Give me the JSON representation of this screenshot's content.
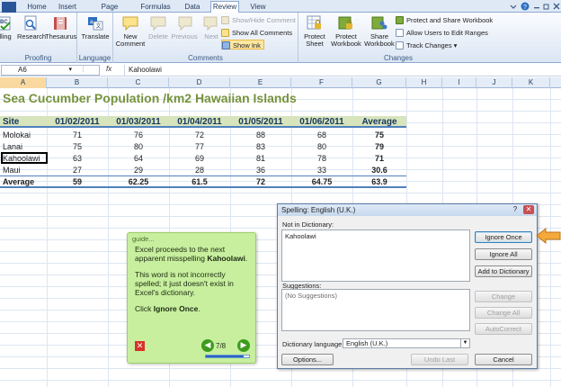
{
  "ribbon": {
    "tabs": [
      "Home",
      "Insert",
      "Page Layout",
      "Formulas",
      "Data",
      "Review",
      "View"
    ],
    "active_tab": "Review",
    "proofing": {
      "spelling": "lling",
      "research": "Research",
      "thesaurus": "Thesaurus",
      "label": "Proofing"
    },
    "language": {
      "translate": "Translate",
      "label": "Language"
    },
    "comments": {
      "new_comment": "New Comment",
      "delete": "Delete",
      "previous": "Previous",
      "next": "Next",
      "show_hide": "Show/Hide Comment",
      "show_all": "Show All Comments",
      "show_ink": "Show Ink",
      "label": "Comments"
    },
    "changes": {
      "protect_sheet": "Protect Sheet",
      "protect_workbook": "Protect Workbook",
      "share_workbook": "Share Workbook",
      "protect_share": "Protect and Share Workbook",
      "allow_users": "Allow Users to Edit Ranges",
      "track_changes": "Track Changes",
      "label": "Changes"
    }
  },
  "formula_bar": {
    "name_box": "A6",
    "fx": "fx",
    "value": "Kahoolawi"
  },
  "columns": [
    "A",
    "B",
    "C",
    "D",
    "E",
    "F",
    "G",
    "H",
    "I",
    "J",
    "K"
  ],
  "sheet": {
    "title": "Sea Cucumber Population /km2 Hawaiian Islands",
    "headers": [
      "Site",
      "01/02/2011",
      "01/03/2011",
      "01/04/2011",
      "01/05/2011",
      "01/06/2011",
      "Average"
    ],
    "rows": [
      [
        "Molokai",
        "71",
        "76",
        "72",
        "88",
        "68",
        "75"
      ],
      [
        "Lanai",
        "75",
        "80",
        "77",
        "83",
        "80",
        "79"
      ],
      [
        "Kahoolawi",
        "63",
        "64",
        "69",
        "81",
        "78",
        "71"
      ],
      [
        "Maui",
        "27",
        "29",
        "28",
        "36",
        "33",
        "30.6"
      ]
    ],
    "average_row": [
      "Average",
      "59",
      "62.25",
      "61.5",
      "72",
      "64.75",
      "63.9"
    ]
  },
  "guide": {
    "title": "guide...",
    "para1_a": "Excel proceeds to the next apparent misspelling ",
    "para1_b": "Kahoolawi",
    "para1_c": ".",
    "para2": "This word is not incorrectly spelled; it just doesn't exist in Excel's dictionary.",
    "para3_a": "Click ",
    "para3_b": "Ignore Once",
    "para3_c": ".",
    "close": "✕",
    "step": "7/8",
    "progress": 0.875
  },
  "spelling_dialog": {
    "title": "Spelling: English (U.K.)",
    "help": "?",
    "close": "✕",
    "not_in_dictionary_label": "Not in Dictionary:",
    "not_in_dictionary_value": "Kahoolawi",
    "ignore_once": "Ignore Once",
    "ignore_all": "Ignore All",
    "add_to_dictionary": "Add to Dictionary",
    "suggestions_label": "Suggestions:",
    "suggestions_value": "(No Suggestions)",
    "change": "Change",
    "change_all": "Change All",
    "autocorrect": "AutoCorrect",
    "dictionary_language_label": "Dictionary language:",
    "dictionary_language_value": "English (U.K.)",
    "options": "Options...",
    "undo_last": "Undo Last",
    "cancel": "Cancel"
  },
  "colors": {
    "title_green": "#76923c",
    "header_band": "#d7e4bc",
    "border_blue": "#4f81bd",
    "guide_green": "#c7ef9e",
    "pointer_orange": "#f4a93a"
  }
}
